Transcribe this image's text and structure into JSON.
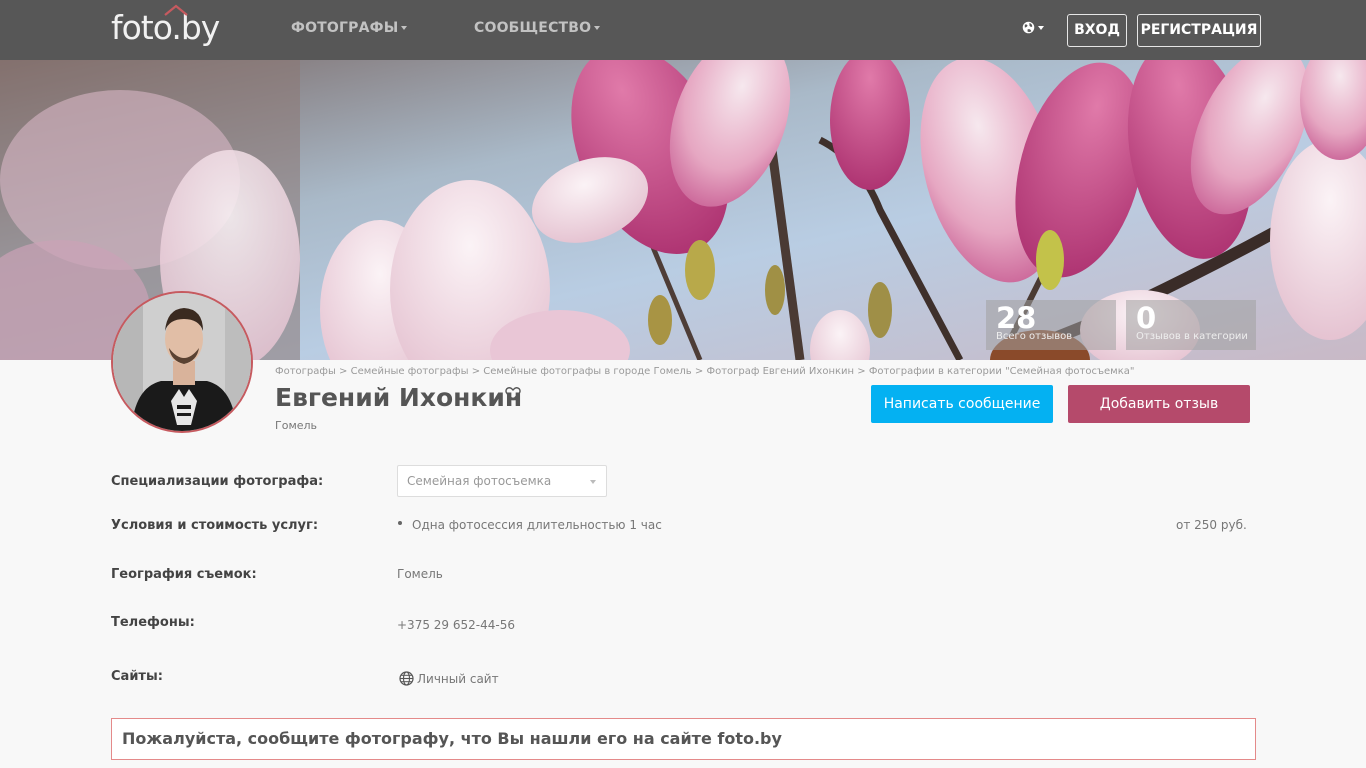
{
  "header": {
    "logo": "foto.by",
    "nav": [
      {
        "label": "ФОТОГРАФЫ"
      },
      {
        "label": "СООБЩЕСТВО"
      }
    ],
    "login": "ВХОД",
    "register": "РЕГИСТРАЦИЯ"
  },
  "stats": [
    {
      "value": "28",
      "label": "Всего отзывов"
    },
    {
      "value": "0",
      "label": "Отзывов в категории"
    }
  ],
  "breadcrumb": [
    "Фотографы",
    "Семейные фотографы",
    "Семейные фотографы в городе Гомель",
    "Фотограф Евгений Ихонкин",
    "Фотографии в категории \"Семейная фотосъемка\""
  ],
  "breadcrumb_sep": ">",
  "profile": {
    "name": "Евгений Ихонкин",
    "city": "Гомель",
    "write_message": "Написать сообщение",
    "add_review": "Добавить отзыв"
  },
  "details": {
    "specializations_label": "Специализации фотографа:",
    "specialization_selected": "Семейная фотосъемка",
    "services_label": "Условия и стоимость услуг:",
    "service_name": "Одна фотосессия длительностью 1 час",
    "service_price": "от 250 руб.",
    "geography_label": "География съемок:",
    "geography_value": "Гомель",
    "phones_label": "Телефоны:",
    "phone_value": "+375 29 652-44-56",
    "sites_label": "Сайты:",
    "site_value": "Личный сайт"
  },
  "notice": "Пожалуйста, сообщите фотографу, что Вы нашли его на сайте foto.by",
  "colors": {
    "topbar": "#575757",
    "message_button": "#04b1f2",
    "review_button": "#b54a6b",
    "avatar_border": "#c65a5f"
  }
}
